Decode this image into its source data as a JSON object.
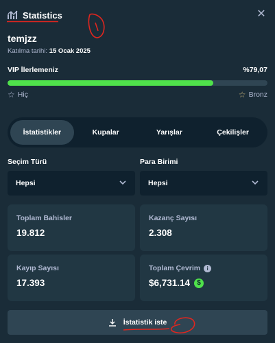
{
  "header": {
    "title": "Statistics",
    "close_icon": "close-icon",
    "title_icon": "bar-chart-icon"
  },
  "user": {
    "name": "temjzz",
    "joined_label": "Katılma tarihi:",
    "joined_date": "15 Ocak 2025"
  },
  "vip": {
    "label": "VIP İlerlemeniz",
    "percent_text": "%79,07",
    "progress": 0.7907,
    "current_rank": "Hiç",
    "next_rank": "Bronz",
    "colors": {
      "fill": "#4fe14b",
      "track": "#2f4553"
    }
  },
  "tabs": [
    {
      "label": "İstatistikler",
      "active": true
    },
    {
      "label": "Kupalar",
      "active": false
    },
    {
      "label": "Yarışlar",
      "active": false
    },
    {
      "label": "Çekilişler",
      "active": false
    }
  ],
  "filters": {
    "type": {
      "label": "Seçim Türü",
      "value": "Hepsi"
    },
    "currency": {
      "label": "Para Birimi",
      "value": "Hepsi"
    }
  },
  "stats": {
    "total_bets": {
      "label": "Toplam Bahisler",
      "value": "19.812"
    },
    "wins": {
      "label": "Kazanç Sayısı",
      "value": "2.308"
    },
    "losses": {
      "label": "Kayıp Sayısı",
      "value": "17.393"
    },
    "wagered": {
      "label": "Toplam Çevrim",
      "value": "$6,731.14"
    }
  },
  "request_button": {
    "label": "İstatistik iste",
    "icon": "download-icon"
  },
  "annotation_color": "#e0261f"
}
